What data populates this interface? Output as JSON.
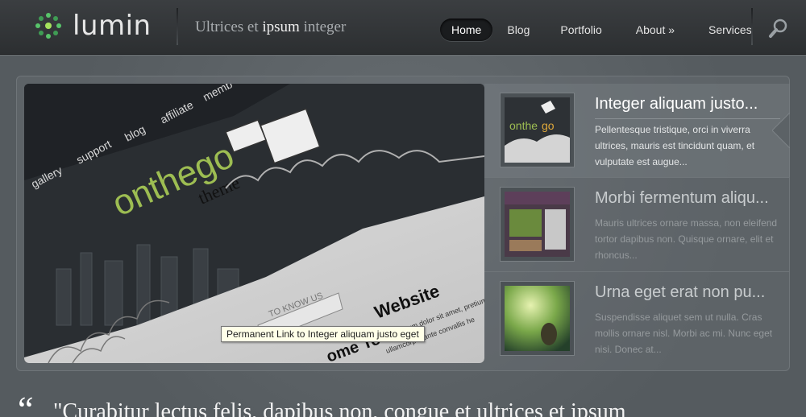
{
  "brand": {
    "name": "lumin",
    "logo_icon": "dots-logo-icon",
    "accent": "#58c46a"
  },
  "tagline": {
    "part1": "Ultrices et ",
    "bold": "ipsum",
    "part2": " integer"
  },
  "nav": {
    "items": [
      {
        "label": "Home",
        "active": true
      },
      {
        "label": "Blog"
      },
      {
        "label": "Portfolio"
      },
      {
        "label": "About »"
      },
      {
        "label": "Services"
      }
    ],
    "search_icon": "search-icon"
  },
  "slide": {
    "alt_lines": [
      "gallery",
      "support",
      "blog",
      "affiliate",
      "memb",
      "onthego",
      "theme",
      "TO KNOW US",
      "Website",
      "ome To O",
      "Lorem ipsum dolor sit amet, pretium nec dap",
      "ullamcorper ante convallis he"
    ],
    "tooltip": "Permanent Link to Integer aliquam justo eget"
  },
  "featured": [
    {
      "title": "Integer aliquam justo...",
      "desc": "Pellentesque tristique, orci in viverra ultrices, mauris est tincidunt quam, et vulputate est augue...",
      "active": true
    },
    {
      "title": "Morbi fermentum aliqu...",
      "desc": "Mauris ultrices ornare massa, non eleifend tortor dapibus non. Quisque ornare, elit et rhoncus..."
    },
    {
      "title": "Urna eget erat non pu...",
      "desc": "Suspendisse aliquet sem ut nulla. Cras mollis ornare nisl. Morbi ac mi. Nunc eget nisi. Donec at..."
    }
  ],
  "quote": {
    "mark": "“",
    "text": "\"Curabitur lectus felis, dapibus non, congue et ultrices et ipsum"
  }
}
